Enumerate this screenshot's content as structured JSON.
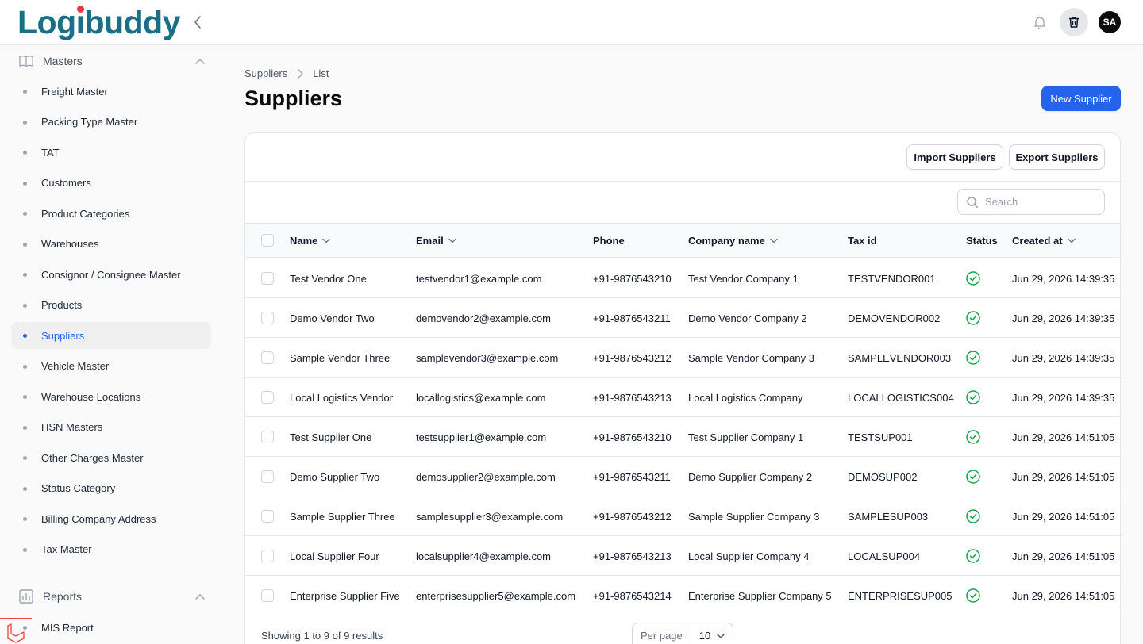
{
  "app": {
    "logo_text": "Logibuddy",
    "user_initials": "SA"
  },
  "sidebar": {
    "groups": [
      {
        "label": "Masters",
        "icon": "book-open-icon"
      },
      {
        "label": "Reports",
        "icon": "bar-chart-icon"
      }
    ],
    "masters_items": [
      {
        "label": "Freight Master"
      },
      {
        "label": "Packing Type Master"
      },
      {
        "label": "TAT"
      },
      {
        "label": "Customers"
      },
      {
        "label": "Product Categories"
      },
      {
        "label": "Warehouses"
      },
      {
        "label": "Consignor / Consignee Master"
      },
      {
        "label": "Products"
      },
      {
        "label": "Suppliers",
        "active": true
      },
      {
        "label": "Vehicle Master"
      },
      {
        "label": "Warehouse Locations"
      },
      {
        "label": "HSN Masters"
      },
      {
        "label": "Other Charges Master"
      },
      {
        "label": "Status Category"
      },
      {
        "label": "Billing Company Address"
      },
      {
        "label": "Tax Master"
      }
    ],
    "reports_items": [
      {
        "label": "MIS Report"
      }
    ]
  },
  "breadcrumb": {
    "root": "Suppliers",
    "current": "List"
  },
  "page": {
    "title": "Suppliers",
    "new_button": "New Supplier"
  },
  "toolbar": {
    "import_label": "Import Suppliers",
    "export_label": "Export Suppliers"
  },
  "search": {
    "placeholder": "Search"
  },
  "table": {
    "columns": [
      {
        "label": "Name",
        "sortable": true
      },
      {
        "label": "Email",
        "sortable": true
      },
      {
        "label": "Phone",
        "sortable": false
      },
      {
        "label": "Company name",
        "sortable": true
      },
      {
        "label": "Tax id",
        "sortable": false
      },
      {
        "label": "Status",
        "sortable": false
      },
      {
        "label": "Created at",
        "sortable": true
      }
    ],
    "rows": [
      {
        "name": "Test Vendor One",
        "email": "testvendor1@example.com",
        "phone": "+91-9876543210",
        "company": "Test Vendor Company 1",
        "tax_id": "TESTVENDOR001",
        "status": "active",
        "created_at": "Jun 29, 2026 14:39:35"
      },
      {
        "name": "Demo Vendor Two",
        "email": "demovendor2@example.com",
        "phone": "+91-9876543211",
        "company": "Demo Vendor Company 2",
        "tax_id": "DEMOVENDOR002",
        "status": "active",
        "created_at": "Jun 29, 2026 14:39:35"
      },
      {
        "name": "Sample Vendor Three",
        "email": "samplevendor3@example.com",
        "phone": "+91-9876543212",
        "company": "Sample Vendor Company 3",
        "tax_id": "SAMPLEVENDOR003",
        "status": "active",
        "created_at": "Jun 29, 2026 14:39:35"
      },
      {
        "name": "Local Logistics Vendor",
        "email": "locallogistics@example.com",
        "phone": "+91-9876543213",
        "company": "Local Logistics Company",
        "tax_id": "LOCALLOGISTICS004",
        "status": "active",
        "created_at": "Jun 29, 2026 14:39:35"
      },
      {
        "name": "Test Supplier One",
        "email": "testsupplier1@example.com",
        "phone": "+91-9876543210",
        "company": "Test Supplier Company 1",
        "tax_id": "TESTSUP001",
        "status": "active",
        "created_at": "Jun 29, 2026 14:51:05"
      },
      {
        "name": "Demo Supplier Two",
        "email": "demosupplier2@example.com",
        "phone": "+91-9876543211",
        "company": "Demo Supplier Company 2",
        "tax_id": "DEMOSUP002",
        "status": "active",
        "created_at": "Jun 29, 2026 14:51:05"
      },
      {
        "name": "Sample Supplier Three",
        "email": "samplesupplier3@example.com",
        "phone": "+91-9876543212",
        "company": "Sample Supplier Company 3",
        "tax_id": "SAMPLESUP003",
        "status": "active",
        "created_at": "Jun 29, 2026 14:51:05"
      },
      {
        "name": "Local Supplier Four",
        "email": "localsupplier4@example.com",
        "phone": "+91-9876543213",
        "company": "Local Supplier Company 4",
        "tax_id": "LOCALSUP004",
        "status": "active",
        "created_at": "Jun 29, 2026 14:51:05"
      },
      {
        "name": "Enterprise Supplier Five",
        "email": "enterprisesupplier5@example.com",
        "phone": "+91-9876543214",
        "company": "Enterprise Supplier Company 5",
        "tax_id": "ENTERPRISESUP005",
        "status": "active",
        "created_at": "Jun 29, 2026 14:51:05"
      }
    ]
  },
  "pagination": {
    "summary": "Showing 1 to 9 of 9 results",
    "per_page_label": "Per page",
    "per_page_value": "10"
  },
  "colors": {
    "primary": "#2563eb",
    "logo": "#1a6f87",
    "logo_dot": "#e63946",
    "success": "#16a34a"
  }
}
